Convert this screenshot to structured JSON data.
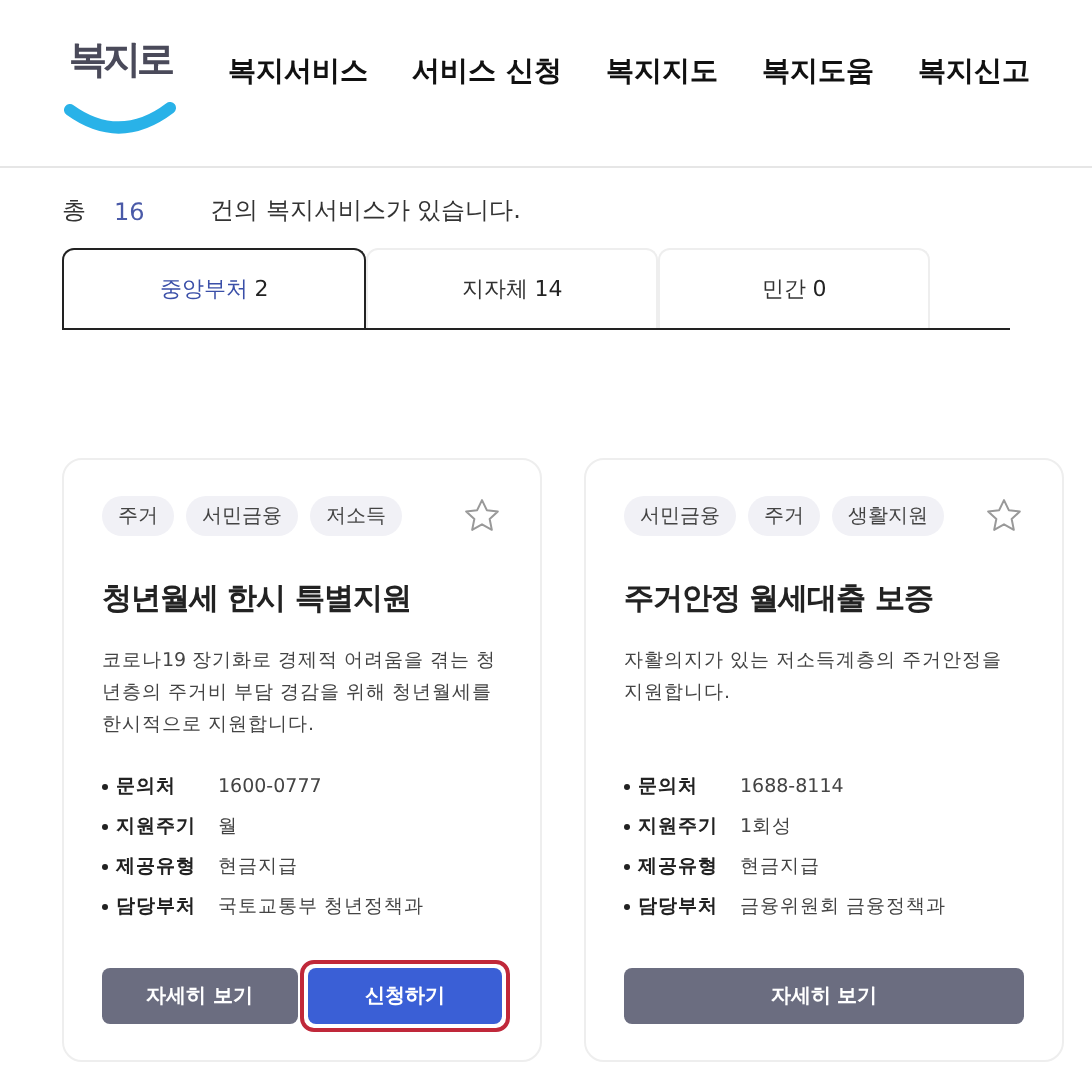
{
  "header": {
    "logo": "복지로",
    "nav": [
      "복지서비스",
      "서비스 신청",
      "복지지도",
      "복지도움",
      "복지신고"
    ]
  },
  "summary": {
    "prefix": "총",
    "count": "16",
    "suffix": "건의 복지서비스가 있습니다."
  },
  "tabs": [
    {
      "label": "중앙부처",
      "count": "2",
      "selected": true
    },
    {
      "label": "지자체",
      "count": "14",
      "selected": false
    },
    {
      "label": "민간",
      "count": "0",
      "selected": false
    }
  ],
  "cards": [
    {
      "tags": [
        "주거",
        "서민금융",
        "저소득"
      ],
      "favorited": false,
      "title": "청년월세 한시 특별지원",
      "description": "코로나19 장기화로 경제적 어려움을 겪는 청년층의 주거비 부담 경감을 위해 청년월세를 한시적으로 지원합니다.",
      "info": [
        {
          "label": "문의처",
          "value": "1600-0777"
        },
        {
          "label": "지원주기",
          "value": "월"
        },
        {
          "label": "제공유형",
          "value": "현금지급"
        },
        {
          "label": "담당부처",
          "value": "국토교통부 청년정책과"
        }
      ],
      "buttons": [
        {
          "label": "자세히 보기",
          "kind": "secondary",
          "highlighted": false
        },
        {
          "label": "신청하기",
          "kind": "primary",
          "highlighted": true
        }
      ]
    },
    {
      "tags": [
        "서민금융",
        "주거",
        "생활지원"
      ],
      "favorited": false,
      "title": "주거안정 월세대출 보증",
      "description": "자활의지가 있는 저소득계층의 주거안정을 지원합니다.",
      "info": [
        {
          "label": "문의처",
          "value": "1688-8114"
        },
        {
          "label": "지원주기",
          "value": "1회성"
        },
        {
          "label": "제공유형",
          "value": "현금지급"
        },
        {
          "label": "담당부처",
          "value": "금융위원회 금융정책과"
        }
      ],
      "buttons": [
        {
          "label": "자세히 보기",
          "kind": "secondary",
          "highlighted": false
        }
      ]
    }
  ]
}
